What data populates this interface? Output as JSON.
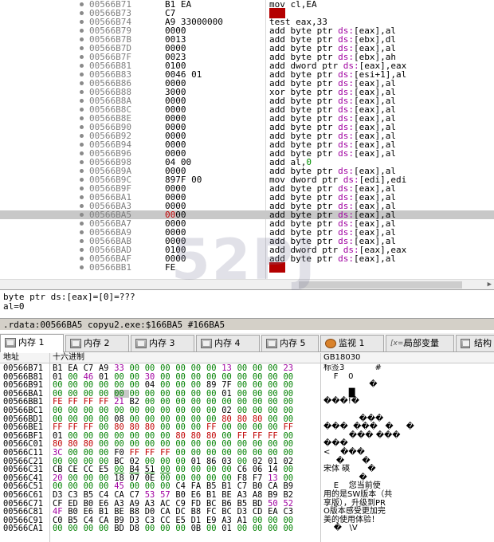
{
  "disasm": {
    "rows": [
      {
        "addr": "00566B71",
        "bytes": "B1 EA",
        "insn": [
          [
            "t",
            "mov cl,EA"
          ]
        ]
      },
      {
        "addr": "00566B73",
        "bytes": "C7",
        "insn": [
          [
            "r",
            "???"
          ]
        ]
      },
      {
        "addr": "00566B74",
        "bytes": "A9 33000000",
        "insn": [
          [
            "t",
            "test eax,33"
          ]
        ]
      },
      {
        "addr": "00566B79",
        "bytes": "0000",
        "insn": [
          [
            "t",
            "add byte ptr "
          ],
          [
            "s",
            "ds:"
          ],
          [
            "t",
            "[eax],al"
          ]
        ]
      },
      {
        "addr": "00566B7B",
        "bytes": "0013",
        "insn": [
          [
            "t",
            "add byte ptr "
          ],
          [
            "s",
            "ds:"
          ],
          [
            "t",
            "[ebx],dl"
          ]
        ]
      },
      {
        "addr": "00566B7D",
        "bytes": "0000",
        "insn": [
          [
            "t",
            "add byte ptr "
          ],
          [
            "s",
            "ds:"
          ],
          [
            "t",
            "[eax],al"
          ]
        ]
      },
      {
        "addr": "00566B7F",
        "bytes": "0023",
        "insn": [
          [
            "t",
            "add byte ptr "
          ],
          [
            "s",
            "ds:"
          ],
          [
            "t",
            "[ebx],ah"
          ]
        ]
      },
      {
        "addr": "00566B81",
        "bytes": "0100",
        "insn": [
          [
            "t",
            "add dword ptr "
          ],
          [
            "s",
            "ds:"
          ],
          [
            "t",
            "[eax],eax"
          ]
        ]
      },
      {
        "addr": "00566B83",
        "bytes": "0046 01",
        "insn": [
          [
            "t",
            "add byte ptr "
          ],
          [
            "s",
            "ds:"
          ],
          [
            "t",
            "[esi+1],al"
          ]
        ]
      },
      {
        "addr": "00566B86",
        "bytes": "0000",
        "insn": [
          [
            "t",
            "add byte ptr "
          ],
          [
            "s",
            "ds:"
          ],
          [
            "t",
            "[eax],al"
          ]
        ]
      },
      {
        "addr": "00566B88",
        "bytes": "3000",
        "insn": [
          [
            "t",
            "xor byte ptr "
          ],
          [
            "s",
            "ds:"
          ],
          [
            "t",
            "[eax],al"
          ]
        ]
      },
      {
        "addr": "00566B8A",
        "bytes": "0000",
        "insn": [
          [
            "t",
            "add byte ptr "
          ],
          [
            "s",
            "ds:"
          ],
          [
            "t",
            "[eax],al"
          ]
        ]
      },
      {
        "addr": "00566B8C",
        "bytes": "0000",
        "insn": [
          [
            "t",
            "add byte ptr "
          ],
          [
            "s",
            "ds:"
          ],
          [
            "t",
            "[eax],al"
          ]
        ]
      },
      {
        "addr": "00566B8E",
        "bytes": "0000",
        "insn": [
          [
            "t",
            "add byte ptr "
          ],
          [
            "s",
            "ds:"
          ],
          [
            "t",
            "[eax],al"
          ]
        ]
      },
      {
        "addr": "00566B90",
        "bytes": "0000",
        "insn": [
          [
            "t",
            "add byte ptr "
          ],
          [
            "s",
            "ds:"
          ],
          [
            "t",
            "[eax],al"
          ]
        ]
      },
      {
        "addr": "00566B92",
        "bytes": "0000",
        "insn": [
          [
            "t",
            "add byte ptr "
          ],
          [
            "s",
            "ds:"
          ],
          [
            "t",
            "[eax],al"
          ]
        ]
      },
      {
        "addr": "00566B94",
        "bytes": "0000",
        "insn": [
          [
            "t",
            "add byte ptr "
          ],
          [
            "s",
            "ds:"
          ],
          [
            "t",
            "[eax],al"
          ]
        ]
      },
      {
        "addr": "00566B96",
        "bytes": "0000",
        "insn": [
          [
            "t",
            "add byte ptr "
          ],
          [
            "s",
            "ds:"
          ],
          [
            "t",
            "[eax],al"
          ]
        ]
      },
      {
        "addr": "00566B98",
        "bytes": "04 00",
        "insn": [
          [
            "t",
            "add al,"
          ],
          [
            "i",
            "0"
          ]
        ]
      },
      {
        "addr": "00566B9A",
        "bytes": "0000",
        "insn": [
          [
            "t",
            "add byte ptr "
          ],
          [
            "s",
            "ds:"
          ],
          [
            "t",
            "[eax],al"
          ]
        ]
      },
      {
        "addr": "00566B9C",
        "bytes": "897F 00",
        "insn": [
          [
            "t",
            "mov dword ptr "
          ],
          [
            "s",
            "ds:"
          ],
          [
            "t",
            "[edi],edi"
          ]
        ]
      },
      {
        "addr": "00566B9F",
        "bytes": "0000",
        "insn": [
          [
            "t",
            "add byte ptr "
          ],
          [
            "s",
            "ds:"
          ],
          [
            "t",
            "[eax],al"
          ]
        ]
      },
      {
        "addr": "00566BA1",
        "bytes": "0000",
        "insn": [
          [
            "t",
            "add byte ptr "
          ],
          [
            "s",
            "ds:"
          ],
          [
            "t",
            "[eax],al"
          ]
        ]
      },
      {
        "addr": "00566BA3",
        "bytes": "0000",
        "insn": [
          [
            "t",
            "add byte ptr "
          ],
          [
            "s",
            "ds:"
          ],
          [
            "t",
            "[eax],al"
          ]
        ]
      },
      {
        "addr": "00566BA5",
        "bytes": "0000",
        "sel": true,
        "insn": [
          [
            "t",
            "add byte ptr "
          ],
          [
            "s",
            "ds:"
          ],
          [
            "t",
            "[eax],al"
          ]
        ]
      },
      {
        "addr": "00566BA7",
        "bytes": "0000",
        "insn": [
          [
            "t",
            "add byte ptr "
          ],
          [
            "s",
            "ds:"
          ],
          [
            "t",
            "[eax],al"
          ]
        ]
      },
      {
        "addr": "00566BA9",
        "bytes": "0000",
        "insn": [
          [
            "t",
            "add byte ptr "
          ],
          [
            "s",
            "ds:"
          ],
          [
            "t",
            "[eax],al"
          ]
        ]
      },
      {
        "addr": "00566BAB",
        "bytes": "0000",
        "insn": [
          [
            "t",
            "add byte ptr "
          ],
          [
            "s",
            "ds:"
          ],
          [
            "t",
            "[eax],al"
          ]
        ]
      },
      {
        "addr": "00566BAD",
        "bytes": "0100",
        "insn": [
          [
            "t",
            "add dword ptr "
          ],
          [
            "s",
            "ds:"
          ],
          [
            "t",
            "[eax],eax"
          ]
        ]
      },
      {
        "addr": "00566BAF",
        "bytes": "0000",
        "insn": [
          [
            "t",
            "add byte ptr "
          ],
          [
            "s",
            "ds:"
          ],
          [
            "t",
            "[eax],al"
          ]
        ]
      },
      {
        "addr": "00566BB1",
        "bytes": "FE",
        "insn": [
          [
            "r",
            "???"
          ]
        ]
      }
    ]
  },
  "info": {
    "line1": "byte ptr ds:[eax]=[0]=???",
    "line2": "al=0"
  },
  "status": {
    "text": ".rdata:00566BA5 copyu2.exe:$166BA5 #166BA5"
  },
  "tabs": [
    {
      "label": "内存 1",
      "icon": "memory-icon"
    },
    {
      "label": "内存 2",
      "icon": "memory-icon"
    },
    {
      "label": "内存 3",
      "icon": "memory-icon"
    },
    {
      "label": "内存 4",
      "icon": "memory-icon"
    },
    {
      "label": "内存 5",
      "icon": "memory-icon"
    },
    {
      "label": "监视 1",
      "icon": "watch-icon"
    },
    {
      "label": "局部变量",
      "icon": "locals-icon"
    },
    {
      "label": "结构",
      "icon": "struct-icon"
    }
  ],
  "dump": {
    "headers": {
      "address": "地址",
      "hex": "十六进制",
      "text": "GB18030"
    },
    "rows": [
      {
        "addr": "00566B71",
        "hex": [
          "B1",
          "EA",
          "C7",
          "A9",
          "33",
          "00",
          "00",
          "00",
          "00",
          "00",
          "00",
          "13",
          "00",
          "00",
          "00",
          "23"
        ],
        "text": "标签3            #"
      },
      {
        "addr": "00566B81",
        "hex": [
          "01",
          "00",
          "46",
          "01",
          "00",
          "00",
          "30",
          "00",
          "00",
          "00",
          "00",
          "00",
          "00",
          "00",
          "00",
          "00"
        ],
        "text": "    F    0"
      },
      {
        "addr": "00566B91",
        "hex": [
          "00",
          "00",
          "00",
          "00",
          "00",
          "00",
          "04",
          "00",
          "00",
          "00",
          "89",
          "7F",
          "00",
          "00",
          "00",
          "00"
        ],
        "text": "                  �"
      },
      {
        "addr": "00566BA1",
        "hex": [
          "00",
          "00",
          "00",
          "00",
          "00",
          "00",
          "00",
          "00",
          "00",
          "00",
          "00",
          "01",
          "00",
          "00",
          "00",
          "00"
        ],
        "text": "          █"
      },
      {
        "addr": "00566BB1",
        "hex": [
          "FE",
          "FF",
          "FF",
          "FF",
          "21",
          "B2",
          "00",
          "00",
          "00",
          "00",
          "00",
          "00",
          "00",
          "00",
          "00",
          "00"
        ],
        "text": "���!�"
      },
      {
        "addr": "00566BC1",
        "hex": [
          "00",
          "00",
          "00",
          "00",
          "00",
          "00",
          "00",
          "00",
          "00",
          "00",
          "00",
          "02",
          "00",
          "00",
          "00",
          "00"
        ],
        "text": ""
      },
      {
        "addr": "00566BD1",
        "hex": [
          "00",
          "00",
          "00",
          "00",
          "08",
          "00",
          "00",
          "00",
          "00",
          "00",
          "00",
          "80",
          "80",
          "80",
          "00",
          "00"
        ],
        "text": "              ���"
      },
      {
        "addr": "00566BE1",
        "hex": [
          "FF",
          "FF",
          "FF",
          "00",
          "80",
          "80",
          "80",
          "00",
          "00",
          "00",
          "FF",
          "00",
          "00",
          "00",
          "00",
          "FF"
        ],
        "text": "���  ���   �     �"
      },
      {
        "addr": "00566BF1",
        "hex": [
          "01",
          "00",
          "00",
          "00",
          "00",
          "00",
          "00",
          "00",
          "80",
          "80",
          "80",
          "00",
          "FF",
          "FF",
          "FF",
          "00"
        ],
        "text": "          ��� ���"
      },
      {
        "addr": "00566C01",
        "hex": [
          "80",
          "80",
          "80",
          "00",
          "00",
          "00",
          "00",
          "00",
          "00",
          "00",
          "00",
          "00",
          "00",
          "00",
          "00",
          "00"
        ],
        "text": "���"
      },
      {
        "addr": "00566C11",
        "hex": [
          "3C",
          "00",
          "00",
          "00",
          "F0",
          "FF",
          "FF",
          "FF",
          "00",
          "00",
          "00",
          "00",
          "00",
          "00",
          "00",
          "00"
        ],
        "text": "<    ���"
      },
      {
        "addr": "00566C21",
        "hex": [
          "00",
          "00",
          "00",
          "00",
          "BC",
          "02",
          "00",
          "00",
          "00",
          "01",
          "86",
          "03",
          "00",
          "02",
          "01",
          "02"
        ],
        "text": "     �       �"
      },
      {
        "addr": "00566C31",
        "hex": [
          "CB",
          "CE",
          "CC",
          "E5",
          "00",
          "B4",
          "51",
          "00",
          "00",
          "00",
          "00",
          "00",
          "C6",
          "06",
          "14",
          "00"
        ],
        "text": "宋体 碤       �"
      },
      {
        "addr": "00566C41",
        "hex": [
          "20",
          "00",
          "00",
          "00",
          "18",
          "07",
          "0E",
          "00",
          "00",
          "00",
          "00",
          "00",
          "F8",
          "F7",
          "13",
          "00"
        ],
        "text": "              �"
      },
      {
        "addr": "00566C51",
        "hex": [
          "00",
          "00",
          "00",
          "00",
          "45",
          "00",
          "00",
          "00",
          "C4",
          "FA",
          "B5",
          "B1",
          "C7",
          "B0",
          "CA",
          "B9"
        ],
        "text": "    E    您当前使"
      },
      {
        "addr": "00566C61",
        "hex": [
          "D3",
          "C3",
          "B5",
          "C4",
          "CA",
          "C7",
          "53",
          "57",
          "B0",
          "E6",
          "B1",
          "BE",
          "A3",
          "A8",
          "B9",
          "B2"
        ],
        "text": "用的是SW版本（共"
      },
      {
        "addr": "00566C71",
        "hex": [
          "CF",
          "ED",
          "B0",
          "E6",
          "A3",
          "A9",
          "A3",
          "AC",
          "C9",
          "FD",
          "BC",
          "B6",
          "B5",
          "BD",
          "50",
          "52"
        ],
        "text": "享版），升级到PR"
      },
      {
        "addr": "00566C81",
        "hex": [
          "4F",
          "B0",
          "E6",
          "B1",
          "BE",
          "B8",
          "D0",
          "CA",
          "DC",
          "B8",
          "FC",
          "BC",
          "D3",
          "CD",
          "EA",
          "C3"
        ],
        "text": "O版本感受更加完"
      },
      {
        "addr": "00566C91",
        "hex": [
          "C0",
          "B5",
          "C4",
          "CA",
          "B9",
          "D3",
          "C3",
          "CC",
          "E5",
          "D1",
          "E9",
          "A3",
          "A1",
          "00",
          "00",
          "00"
        ],
        "text": "美的使用体验！"
      },
      {
        "addr": "00566CA1",
        "hex": [
          "00",
          "00",
          "00",
          "00",
          "BD",
          "D8",
          "00",
          "00",
          "00",
          "0B",
          "00",
          "01",
          "00",
          "00",
          "00",
          "00"
        ],
        "text": "    �   \\V"
      }
    ]
  },
  "watermark": {
    "text": "52PJ"
  },
  "colors": {
    "accent": "#c00000",
    "selection": "#c8c8c8",
    "segment": "#a000a0",
    "immediate": "#009000"
  }
}
